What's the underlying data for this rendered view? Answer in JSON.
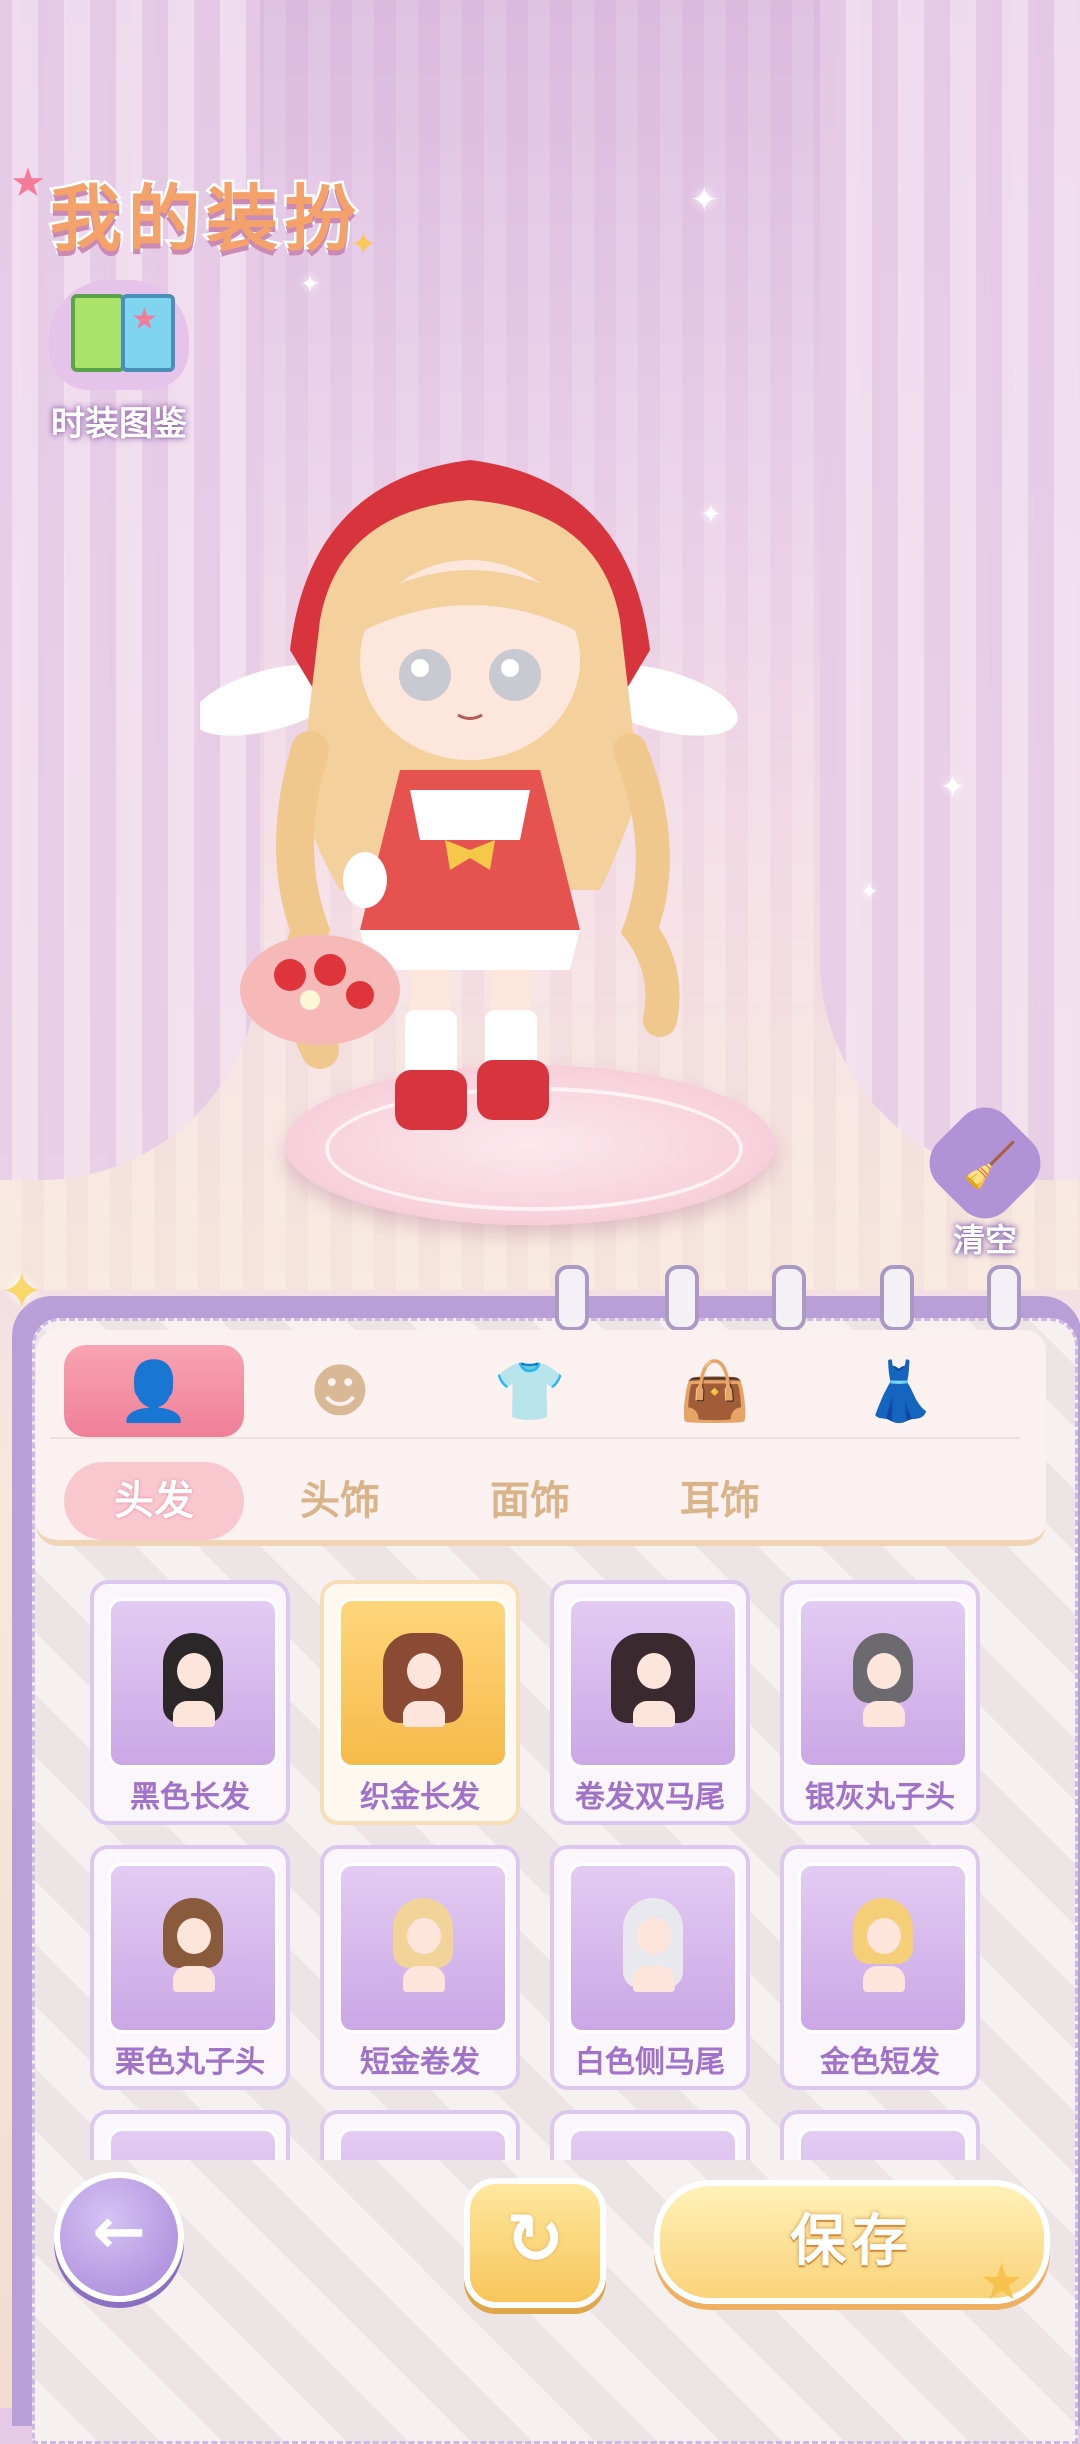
{
  "header": {
    "title": "我的装扮"
  },
  "lookbook": {
    "label": "时装图鉴"
  },
  "clear": {
    "label": "清空"
  },
  "categories": [
    {
      "icon": "hair-icon",
      "active": true
    },
    {
      "icon": "face-icon",
      "active": false
    },
    {
      "icon": "shirt-icon",
      "active": false
    },
    {
      "icon": "bag-icon",
      "active": false
    },
    {
      "icon": "dress-icon",
      "active": false
    }
  ],
  "subtabs": [
    "头发",
    "头饰",
    "面饰",
    "耳饰"
  ],
  "items": [
    {
      "name": "黑色长发",
      "hair": "#2b2628",
      "selected": false
    },
    {
      "name": "织金长发",
      "hair": "#8a4a33",
      "selected": true
    },
    {
      "name": "卷发双马尾",
      "hair": "#3a2a30",
      "selected": false
    },
    {
      "name": "银灰丸子头",
      "hair": "#6c6a6e",
      "selected": false
    },
    {
      "name": "栗色丸子头",
      "hair": "#8a5a3c",
      "selected": false
    },
    {
      "name": "短金卷发",
      "hair": "#f2d49a",
      "selected": false
    },
    {
      "name": "白色侧马尾",
      "hair": "#e8e8ee",
      "selected": false
    },
    {
      "name": "金色短发",
      "hair": "#f5cf77",
      "selected": false
    }
  ],
  "buttons": {
    "back": "←",
    "refresh": "↻",
    "save": "保存"
  }
}
